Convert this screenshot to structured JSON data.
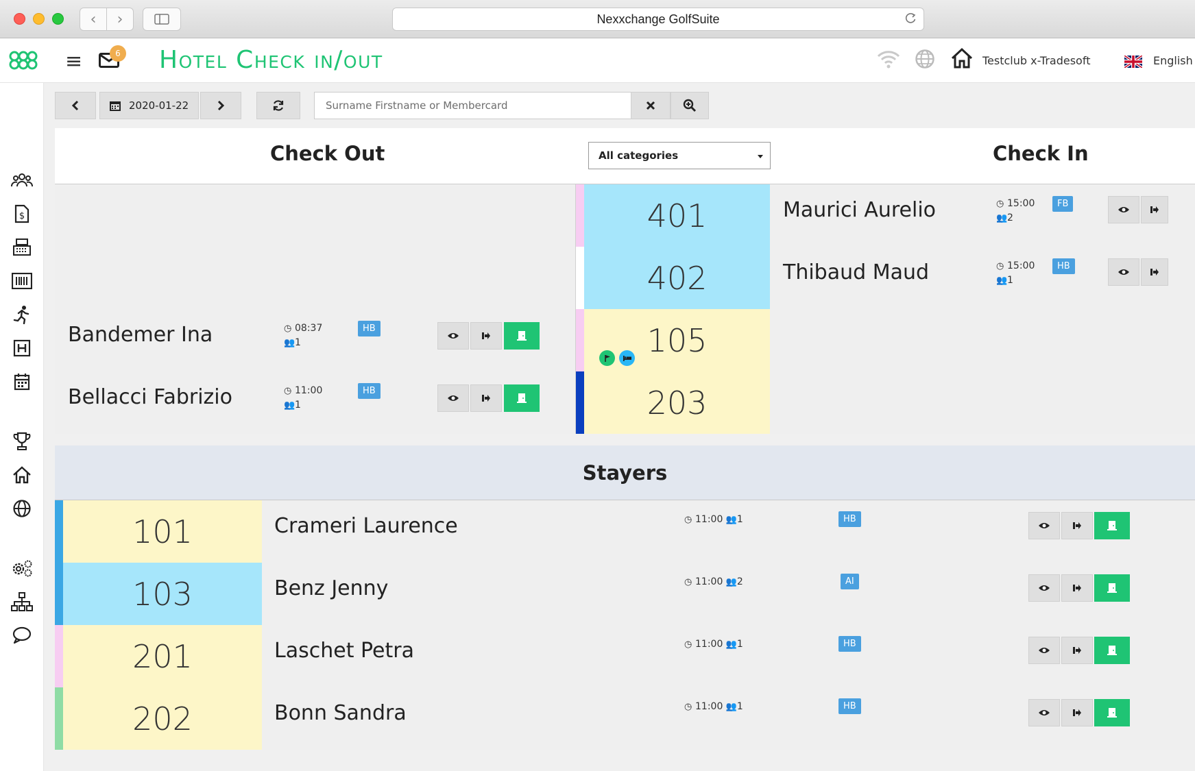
{
  "browser": {
    "url_title": "Nexxchange GolfSuite"
  },
  "header": {
    "title": "Hotel Check in/out",
    "mail_count": "6",
    "club": "Testclub x-Tradesoft",
    "language": "English"
  },
  "toolbar": {
    "date": "2020-01-22",
    "search_placeholder": "Surname Firstname or Membercard"
  },
  "sections": {
    "check_out": "Check Out",
    "check_in": "Check In",
    "category_filter": "All categories",
    "stayers": "Stayers"
  },
  "colors": {
    "accent": "#1fc474",
    "badge": "#4aa0df",
    "room_blue": "#a6e6fb",
    "room_yellow": "#fdf6c8",
    "stayers_header": "#e2e7ef"
  },
  "rows": [
    {
      "checkout": null,
      "room": "401",
      "room_color": "#a6e6fb",
      "strip_color": "#f7cdf2",
      "checkin": {
        "name": "Maurici Aurelio",
        "time": "15:00",
        "persons": "2",
        "board": "FB"
      }
    },
    {
      "checkout": null,
      "room": "402",
      "room_color": "#a6e6fb",
      "strip_color": "#ffffff",
      "checkin": {
        "name": "Thibaud Maud",
        "time": "15:00",
        "persons": "1",
        "board": "HB"
      }
    },
    {
      "checkout": {
        "name": "Bandemer Ina",
        "time": "08:37",
        "persons": "1",
        "board": "HB"
      },
      "room": "105",
      "room_color": "#fdf6c8",
      "strip_color": "#f7cdf2",
      "room_icons": [
        "flag-icon",
        "bed-icon"
      ],
      "checkin": null
    },
    {
      "checkout": {
        "name": "Bellacci Fabrizio",
        "time": "11:00",
        "persons": "1",
        "board": "HB"
      },
      "room": "203",
      "room_color": "#fdf6c8",
      "strip_color": "#0a3fbf",
      "checkin": null
    }
  ],
  "stayers": [
    {
      "room": "101",
      "strip_color": "#3aa7e4",
      "room_color": "#fdf6c8",
      "name": "Crameri Laurence",
      "time": "11:00",
      "persons": "1",
      "board": "HB"
    },
    {
      "room": "103",
      "strip_color": "#3aa7e4",
      "room_color": "#a6e6fb",
      "name": "Benz Jenny",
      "time": "11:00",
      "persons": "2",
      "board": "AI"
    },
    {
      "room": "201",
      "strip_color": "#f7cdf2",
      "room_color": "#fdf6c8",
      "name": "Laschet Petra",
      "time": "11:00",
      "persons": "1",
      "board": "HB"
    },
    {
      "room": "202",
      "strip_color": "#8fdca5",
      "room_color": "#fdf6c8",
      "name": "Bonn Sandra",
      "time": "11:00",
      "persons": "1",
      "board": "HB"
    }
  ]
}
